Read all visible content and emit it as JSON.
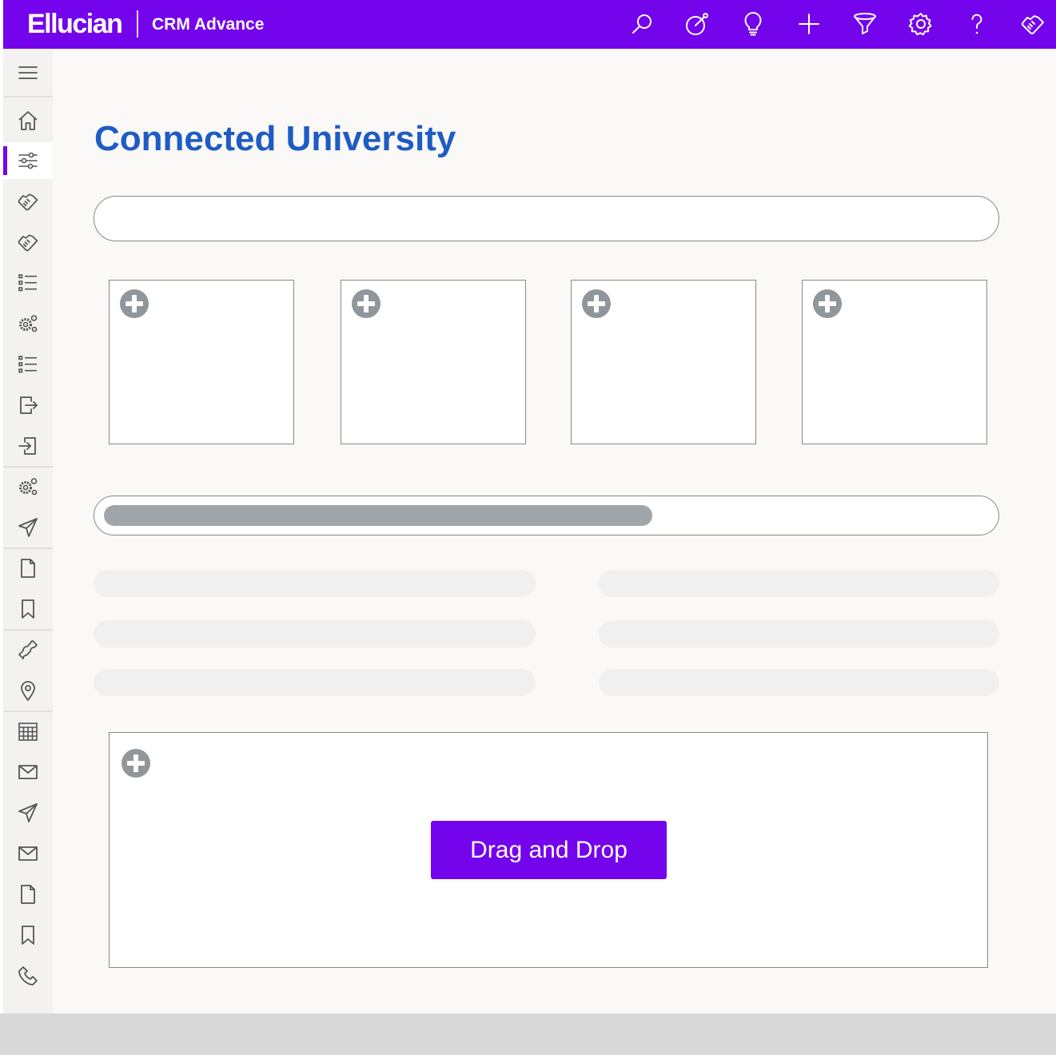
{
  "header": {
    "brand": "Ellucian",
    "product": "CRM Advance",
    "icons": [
      "search-icon",
      "target-icon",
      "lightbulb-icon",
      "plus-icon",
      "funnel-icon",
      "gear-icon",
      "help-icon",
      "handshake-icon"
    ]
  },
  "sidebar": {
    "active_index": 1,
    "icons": [
      "menu-icon",
      "home-icon",
      "sliders-icon",
      "handshake-icon",
      "handshake-icon",
      "list-icon",
      "gears-icon",
      "checklist-icon",
      "export-icon",
      "import-icon",
      "gears-icon",
      "send-icon",
      "document-icon",
      "bookmark-icon",
      "phone-icon",
      "location-pin-icon",
      "calendar-icon",
      "mail-icon",
      "send-icon",
      "mail-icon",
      "document-icon",
      "bookmark-icon",
      "phone-icon"
    ]
  },
  "main": {
    "title": "Connected University",
    "progress_fraction": 0.62,
    "cards": [
      {
        "icon": "plus-circle-icon"
      },
      {
        "icon": "plus-circle-icon"
      },
      {
        "icon": "plus-circle-icon"
      },
      {
        "icon": "plus-circle-icon"
      }
    ],
    "dropzone": {
      "button_label": "Drag and Drop"
    }
  },
  "colors": {
    "brand": "#7404ec",
    "title": "#1f5bc4",
    "neutral": "#a0a5aa",
    "skeleton": "#f1f0f1",
    "footer": "#d9d9d9"
  }
}
